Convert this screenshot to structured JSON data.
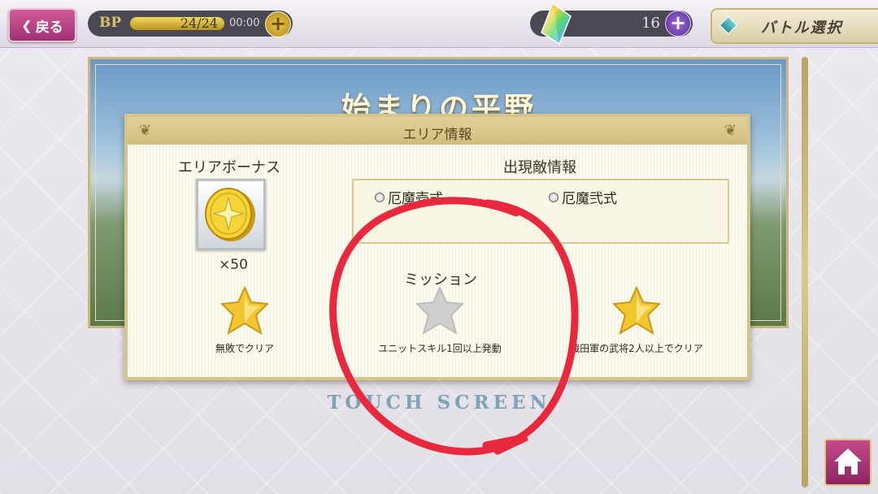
{
  "header": {
    "back_label": "戻る",
    "bp": {
      "label": "BP",
      "value": "24/24",
      "fill_fraction": 1.0,
      "timer": "00:00"
    },
    "gems": {
      "count": "16"
    },
    "battle_select_label": "バトル選択"
  },
  "stage": {
    "title": "始まりの平野"
  },
  "dialog": {
    "title": "エリア情報",
    "area_bonus": {
      "label": "エリアボーナス",
      "count": "×50"
    },
    "enemy_info": {
      "label": "出現敵情報",
      "enemies": [
        "厄魔壱式",
        "厄魔弐式"
      ]
    },
    "mission": {
      "label": "ミッション",
      "items": [
        {
          "text": "無敗でクリア",
          "achieved": true
        },
        {
          "text": "ユニットスキル1回以上発動",
          "achieved": false
        },
        {
          "text": "織田軍の武将2人以上でクリア",
          "achieved": true
        }
      ]
    }
  },
  "touch_screen": "TOUCH SCREEN",
  "colors": {
    "accent_gold": "#d6c58a",
    "back_button": "#c1447f",
    "star_gold": "#f2c531",
    "star_gray": "#cfcfcf",
    "annotation_red": "#e8283c"
  },
  "icons": [
    "chevron-left-icon",
    "plus-icon",
    "rainbow-gem-icon",
    "diamond-icon",
    "gold-coin-icon",
    "star-icon",
    "home-icon"
  ]
}
